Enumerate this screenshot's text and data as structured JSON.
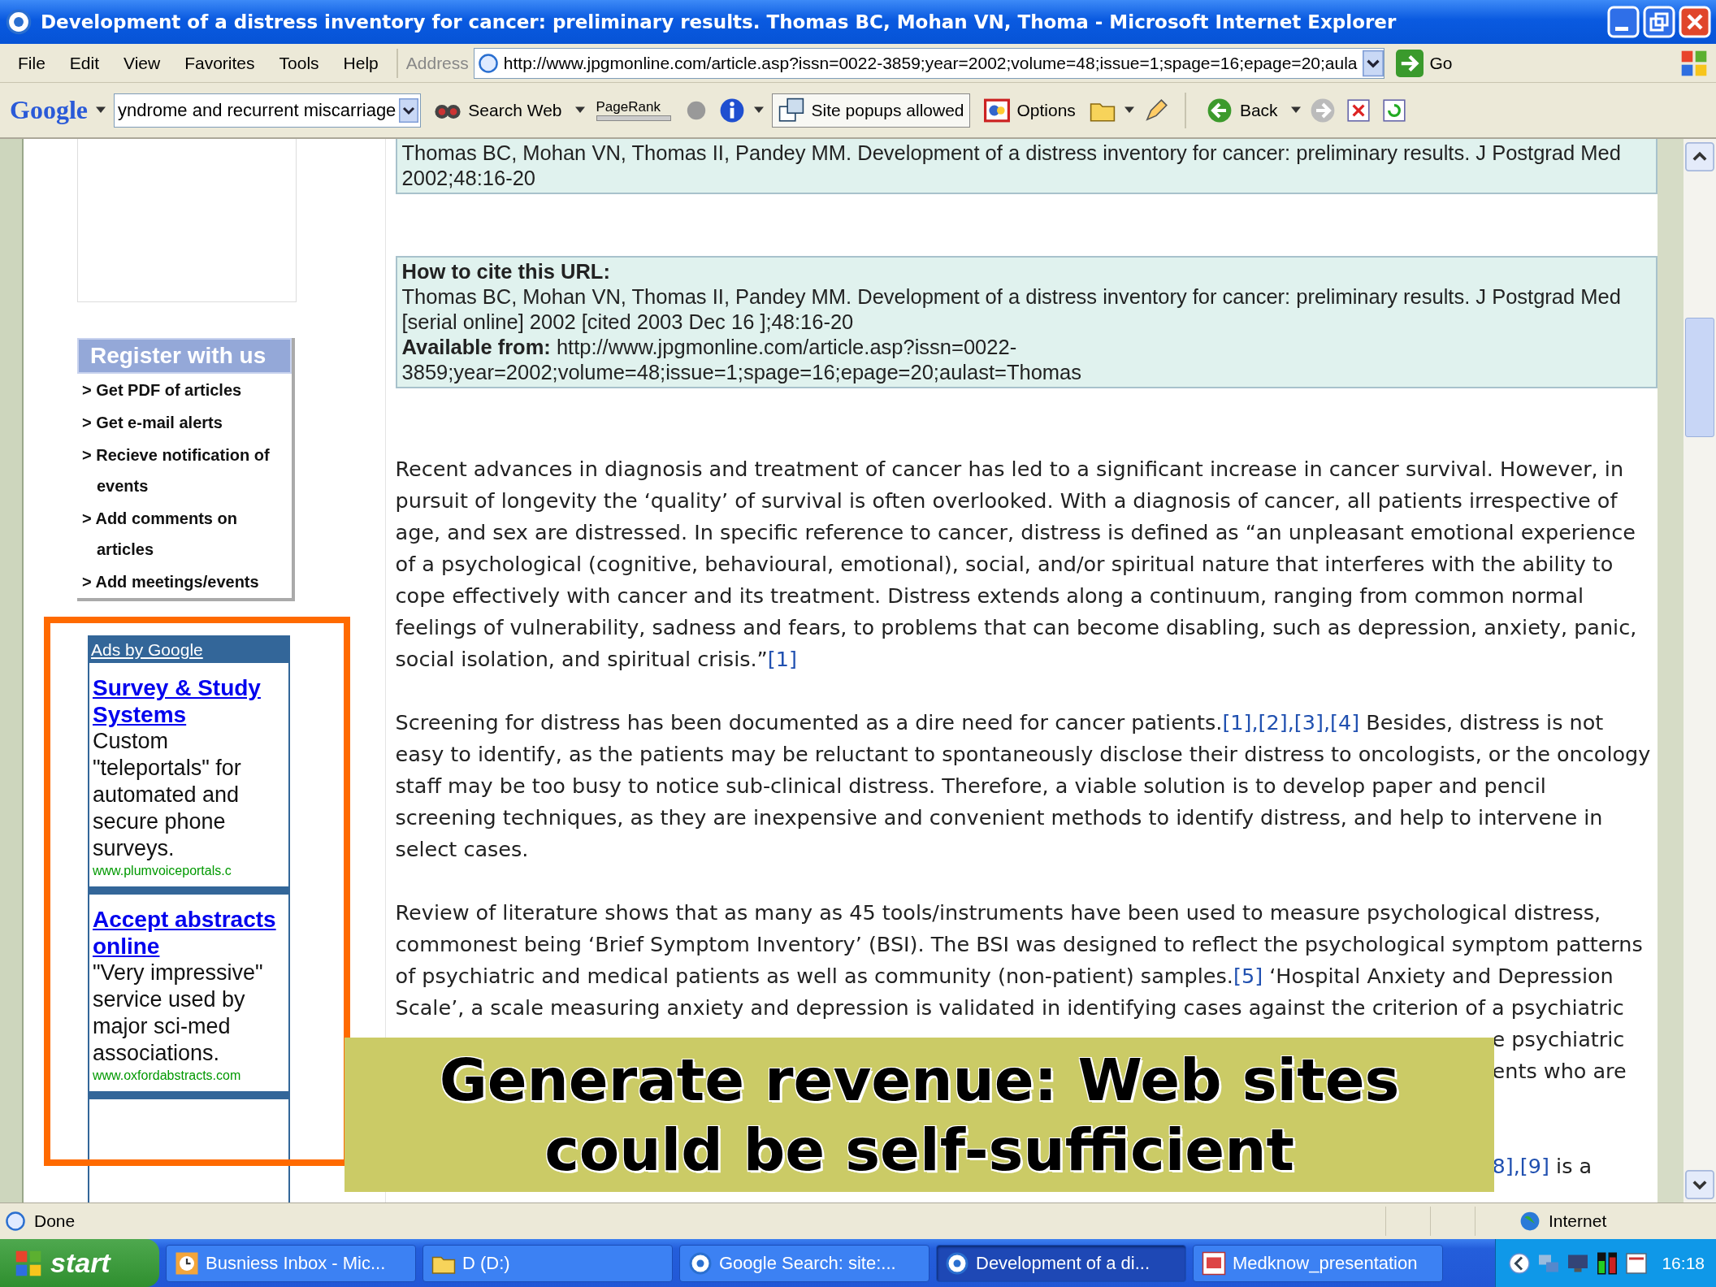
{
  "window": {
    "title": "Development of a distress inventory for cancer: preliminary results. Thomas BC, Mohan VN, Thoma - Microsoft Internet Explorer"
  },
  "menu": [
    "File",
    "Edit",
    "View",
    "Favorites",
    "Tools",
    "Help"
  ],
  "address": {
    "label": "Address",
    "url": "http://www.jpgmonline.com/article.asp?issn=0022-3859;year=2002;volume=48;issue=1;spage=16;epage=20;aula",
    "go": "Go"
  },
  "google_toolbar": {
    "logo": "Google",
    "search_value": "yndrome and recurrent miscarriage",
    "search_web": "Search Web",
    "pagerank": "PageRank",
    "popups": "Site popups allowed",
    "options": "Options",
    "back": "Back"
  },
  "sidebar": {
    "register_title": "Register with us",
    "items": [
      "> Get PDF of articles",
      "> Get e-mail alerts",
      "> Recieve notification of events",
      "> Add comments on articles",
      "> Add meetings/events"
    ]
  },
  "ads": {
    "header": "Ads by Google",
    "items": [
      {
        "title": "Survey & Study Systems",
        "text": "Custom \"teleportals\" for automated and secure phone surveys.",
        "url": "www.plumvoiceportals.c"
      },
      {
        "title": "Accept abstracts online",
        "text": "\"Very impressive\" service used by major sci-med associations.",
        "url": "www.oxfordabstracts.com"
      }
    ]
  },
  "citations": [
    {
      "text": "Thomas BC, Mohan VN, Thomas II, Pandey MM. Development of a distress inventory for cancer: preliminary results. J Postgrad Med 2002;48:16-20"
    },
    {
      "heading": "How to cite this URL:",
      "text": "Thomas BC, Mohan VN, Thomas II, Pandey MM. Development of a distress inventory for cancer: preliminary results. J Postgrad Med [serial online] 2002 [cited 2003 Dec 16 ];48:16-20",
      "available": "**Available from:** http://www.jpgmonline.com/article.asp?issn=0022-3859;year=2002;volume=48;issue=1;spage=16;epage=20;aulast=Thomas"
    }
  ],
  "paragraphs": [
    [
      {
        "kind": "text",
        "text": "Recent advances in diagnosis and treatment of cancer has led to a significant increase in cancer survival. However, in pursuit of longevity the ‘quality’ of survival is often overlooked. With a diagnosis of cancer, all patients irrespective of age, and sex are distressed. In specific reference to cancer, distress is defined as “an unpleasant emotional experience of a psychological (cognitive, behavioural, emotional), social, and/or spiritual nature that interferes with the ability to cope effectively with cancer and its treatment. Distress extends along a continuum, ranging from common normal feelings of vulnerability, sadness and fears, to problems that can become disabling, such as depression, anxiety, panic, social isolation, and spiritual crisis.”"
      },
      {
        "kind": "link",
        "text": "[1]"
      }
    ],
    [
      {
        "kind": "text",
        "text": "Screening for distress has been documented as a dire need for cancer patients."
      },
      {
        "kind": "link",
        "text": "[1],[2],[3],[4]"
      },
      {
        "kind": "text",
        "text": " Besides, distress is not easy to identify, as the patients may be reluctant to spontaneously disclose their distress to oncologists, or the oncology staff may be too busy to notice sub-clinical distress. Therefore, a viable solution is to develop paper and pencil screening techniques, as they are inexpensive and convenient methods to identify distress, and help to intervene in select cases."
      }
    ],
    [
      {
        "kind": "text",
        "text": "Review of literature shows that as many as 45 tools/instruments have been used to measure psychological distress, commonest being ‘Brief Symptom Inventory’ (BSI). The BSI was designed to reflect the psychological symptom patterns of psychiatric and medical patients as well as community (non-patient) samples."
      },
      {
        "kind": "link",
        "text": "[5]"
      },
      {
        "kind": "text",
        "text": " ‘Hospital Anxiety and Depression Scale’, a scale measuring anxiety and depression is validated in identifying cases against the criterion of a psychiatric"
      }
    ]
  ],
  "hidden_fragments": [
    [
      {
        "kind": "text",
        "text": "e psychiatric"
      }
    ],
    [
      {
        "kind": "text",
        "text": "ents who are"
      }
    ],
    [
      {
        "kind": "link",
        "text": "8],[9]"
      },
      {
        "kind": "text",
        "text": " is a"
      }
    ]
  ],
  "overlay_caption": "Generate revenue: Web sites could be self-sufficient",
  "status_bar": {
    "text": "Done",
    "zone": "Internet"
  },
  "taskbar": {
    "start": "start",
    "items": [
      {
        "label": "Busniess Inbox - Mic...",
        "selected": false,
        "kind": "clock"
      },
      {
        "label": "D (D:)",
        "selected": false,
        "kind": "folder"
      },
      {
        "label": "Google Search: site:...",
        "selected": false,
        "kind": "ie"
      },
      {
        "label": "Development of a di...",
        "selected": true,
        "kind": "ie"
      },
      {
        "label": "Medknow_presentation",
        "selected": false,
        "kind": "ppt"
      }
    ],
    "time": "16:18"
  }
}
